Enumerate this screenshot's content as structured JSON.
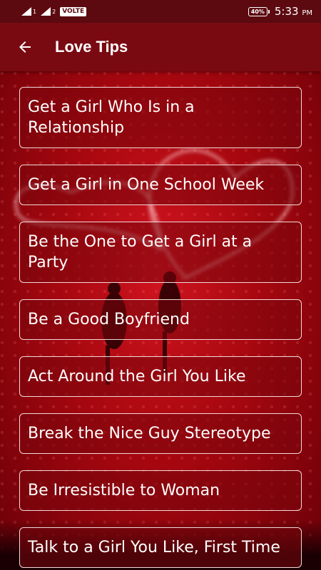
{
  "status_bar": {
    "sim1": "1",
    "sim2": "2",
    "network_badge": "VOLTE",
    "battery": "40%",
    "time": "5:33",
    "ampm": "PM"
  },
  "app_bar": {
    "title": "Love Tips",
    "back_icon": "arrow-left-icon"
  },
  "tips": [
    "Get a Girl Who Is in a Relationship",
    "Get a Girl in One School Week",
    "Be the One to Get a Girl at a Party",
    "Be a Good Boyfriend",
    "Act Around the Girl You Like",
    "Break the Nice Guy Stereotype",
    "Be Irresistible to Woman",
    "Talk to a Girl You Like, First Time"
  ],
  "colors": {
    "status_bar": "#5c0a10",
    "app_bar": "#7a0a12",
    "background": "#b00a14",
    "item_border": "#f1d9da"
  }
}
